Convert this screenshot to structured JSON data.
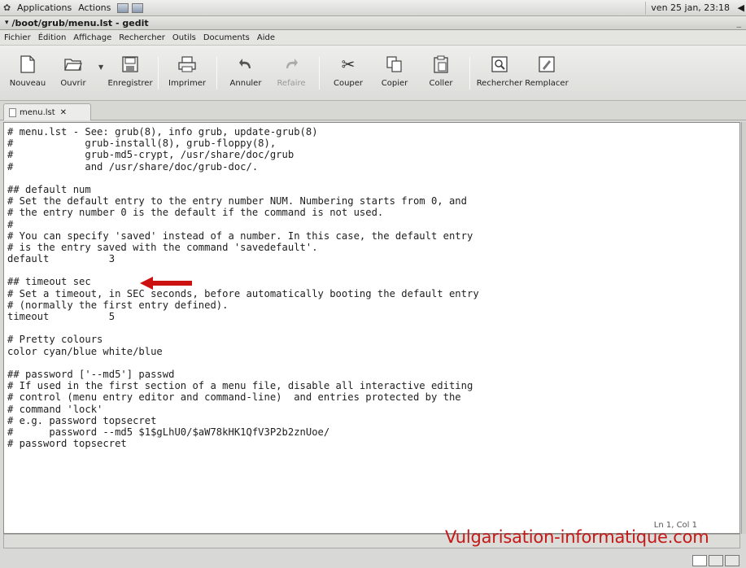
{
  "panel": {
    "menus": [
      "Applications",
      "Actions"
    ],
    "clock": "ven 25 jan, 23:18"
  },
  "window": {
    "title": "/boot/grub/menu.lst - gedit"
  },
  "menubar": [
    "Fichier",
    "Édition",
    "Affichage",
    "Rechercher",
    "Outils",
    "Documents",
    "Aide"
  ],
  "toolbar": {
    "new": "Nouveau",
    "open": "Ouvrir",
    "save": "Enregistrer",
    "print": "Imprimer",
    "undo": "Annuler",
    "redo": "Refaire",
    "cut": "Couper",
    "copy": "Copier",
    "paste": "Coller",
    "find": "Rechercher",
    "replace": "Remplacer"
  },
  "tab": {
    "label": "menu.lst",
    "close": "✕"
  },
  "code_lines": [
    "# menu.lst - See: grub(8), info grub, update-grub(8)",
    "#            grub-install(8), grub-floppy(8),",
    "#            grub-md5-crypt, /usr/share/doc/grub",
    "#            and /usr/share/doc/grub-doc/.",
    "",
    "## default num",
    "# Set the default entry to the entry number NUM. Numbering starts from 0, and",
    "# the entry number 0 is the default if the command is not used.",
    "#",
    "# You can specify 'saved' instead of a number. In this case, the default entry",
    "# is the entry saved with the command 'savedefault'.",
    "default          3",
    "",
    "## timeout sec",
    "# Set a timeout, in SEC seconds, before automatically booting the default entry",
    "# (normally the first entry defined).",
    "timeout          5",
    "",
    "# Pretty colours",
    "color cyan/blue white/blue",
    "",
    "## password ['--md5'] passwd",
    "# If used in the first section of a menu file, disable all interactive editing",
    "# control (menu entry editor and command-line)  and entries protected by the",
    "# command 'lock'",
    "# e.g. password topsecret",
    "#      password --md5 $1$gLhU0/$aW78kHK1QfV3P2b2znUoe/",
    "# password topsecret"
  ],
  "watermark": "Vulgarisation-informatique.com",
  "status_position": "Ln 1, Col 1",
  "colors": {
    "arrow": "#cc1111",
    "watermark": "#c41a1a"
  }
}
